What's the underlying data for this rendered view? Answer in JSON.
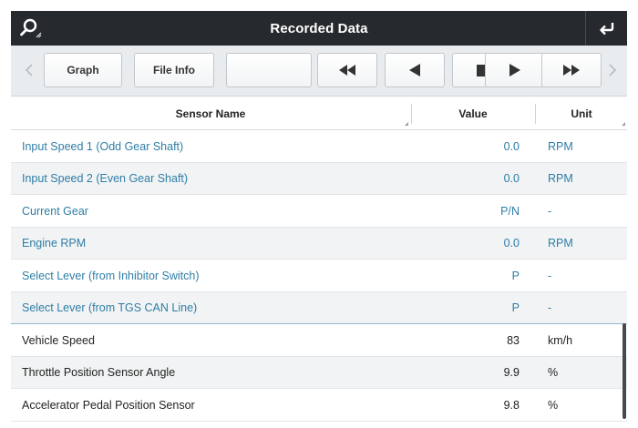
{
  "header": {
    "title": "Recorded Data",
    "left_icon": "search-icon",
    "right_icon": "return-icon"
  },
  "toolbar": {
    "graph_label": "Graph",
    "file_info_label": "File Info",
    "blank_label": "",
    "icons": [
      "chevron-left-icon",
      "rewind-icon",
      "step-back-icon",
      "stop-icon",
      "play-icon",
      "fast-forward-icon",
      "chevron-right-icon"
    ]
  },
  "table": {
    "headers": {
      "name": "Sensor Name",
      "value": "Value",
      "unit": "Unit"
    },
    "rows": [
      {
        "name": "Input Speed 1 (Odd Gear Shaft)",
        "value": "0.0",
        "unit": "RPM"
      },
      {
        "name": "Input Speed 2 (Even Gear Shaft)",
        "value": "0.0",
        "unit": "RPM"
      },
      {
        "name": "Current Gear",
        "value": "P/N",
        "unit": "-"
      },
      {
        "name": "Engine RPM",
        "value": "0.0",
        "unit": "RPM"
      },
      {
        "name": "Select Lever (from Inhibitor Switch)",
        "value": "P",
        "unit": "-"
      },
      {
        "name": "Select Lever (from TGS CAN Line)",
        "value": "P",
        "unit": "-"
      },
      {
        "name": "Vehicle Speed",
        "value": "83",
        "unit": "km/h"
      },
      {
        "name": "Throttle Position Sensor Angle",
        "value": "9.9",
        "unit": "%"
      },
      {
        "name": "Accelerator Pedal Position Sensor",
        "value": "9.8",
        "unit": "%"
      }
    ]
  },
  "colors": {
    "titlebar_bg": "#262a2e",
    "selected_text": "#2f7ea6",
    "normal_text": "#222222",
    "toolbar_bg": "#e9ecee"
  }
}
